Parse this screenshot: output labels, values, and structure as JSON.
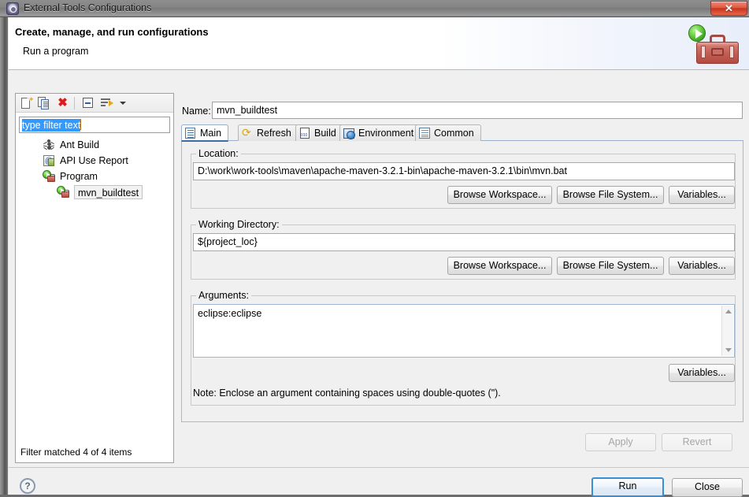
{
  "window": {
    "title": "External Tools Configurations",
    "title_icon": "external-tools-icon",
    "close_glyph": "✕"
  },
  "banner": {
    "title": "Create, manage, and run configurations",
    "subtitle": "Run a program",
    "icon": "run-toolbox-icon"
  },
  "tree_toolbar": {
    "buttons": [
      {
        "name": "new-configuration",
        "icon": "new-page-icon"
      },
      {
        "name": "duplicate-configuration",
        "icon": "duplicate-icon"
      },
      {
        "name": "delete-configuration",
        "icon": "delete-x-icon"
      },
      {
        "name": "collapse-all",
        "icon": "collapse-all-icon"
      },
      {
        "name": "filter-configurations",
        "icon": "filter-icon"
      },
      {
        "name": "filter-menu",
        "icon": "chevron-down-icon"
      }
    ]
  },
  "filter": {
    "value": "type filter text",
    "placeholder": "type filter text",
    "status": "Filter matched 4 of 4 items"
  },
  "tree": {
    "items": [
      {
        "label": "Ant Build",
        "icon": "ant-icon",
        "indent": 0,
        "selected": false
      },
      {
        "label": "API Use Report",
        "icon": "api-use-report-icon",
        "indent": 0,
        "selected": false
      },
      {
        "label": "Program",
        "icon": "program-icon",
        "indent": 0,
        "selected": false
      },
      {
        "label": "mvn_buildtest",
        "icon": "program-icon",
        "indent": 1,
        "selected": true
      }
    ]
  },
  "name_field": {
    "label": "Name:",
    "value": "mvn_buildtest"
  },
  "tabs": [
    {
      "label": "Main",
      "icon": "main-tab-icon",
      "active": true
    },
    {
      "label": "Refresh",
      "icon": "refresh-tab-icon",
      "active": false
    },
    {
      "label": "Build",
      "icon": "build-tab-icon",
      "active": false
    },
    {
      "label": "Environment",
      "icon": "environment-tab-icon",
      "active": false
    },
    {
      "label": "Common",
      "icon": "common-tab-icon",
      "active": false
    }
  ],
  "main_tab": {
    "location": {
      "legend": "Location:",
      "value": "D:\\work\\work-tools\\maven\\apache-maven-3.2.1-bin\\apache-maven-3.2.1\\bin\\mvn.bat",
      "browse_workspace": "Browse Workspace...",
      "browse_file_system": "Browse File System...",
      "variables": "Variables..."
    },
    "working_directory": {
      "legend": "Working Directory:",
      "value": "${project_loc}",
      "browse_workspace": "Browse Workspace...",
      "browse_file_system": "Browse File System...",
      "variables": "Variables..."
    },
    "arguments": {
      "legend": "Arguments:",
      "value": "eclipse:eclipse",
      "variables": "Variables...",
      "note": "Note: Enclose an argument containing spaces using double-quotes (\")."
    }
  },
  "footer": {
    "apply": "Apply",
    "revert": "Revert",
    "run": "Run",
    "close": "Close",
    "help_glyph": "?"
  },
  "colors": {
    "accent": "#3a8fd4",
    "selection": "#3399ff",
    "dialog_bg": "#f0f0f0",
    "close_red": "#c8351d",
    "play_green": "#6ece46",
    "toolbox_red": "#b8493d"
  }
}
